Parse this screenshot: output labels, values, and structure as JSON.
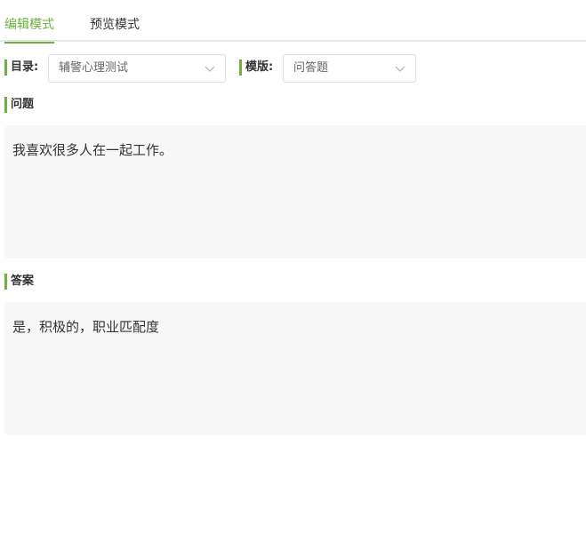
{
  "tabs": [
    {
      "label": "编辑模式",
      "active": true
    },
    {
      "label": "预览模式",
      "active": false
    }
  ],
  "catalog": {
    "label": "目录:",
    "value": "辅警心理测试"
  },
  "template": {
    "label": "模版:",
    "value": "问答题"
  },
  "question": {
    "label": "问题",
    "text": "我喜欢很多人在一起工作。"
  },
  "answer": {
    "label": "答案",
    "text": "是，积极的，职业匹配度"
  },
  "colors": {
    "accent": "#6cb33e",
    "panel": "#f7f7f7"
  }
}
